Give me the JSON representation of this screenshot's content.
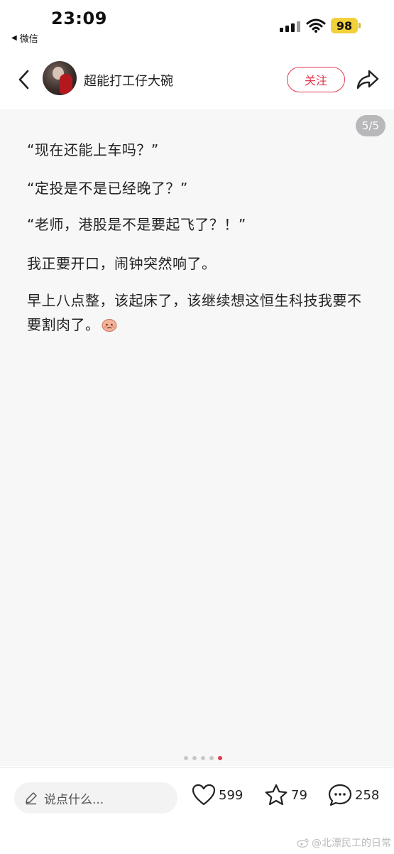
{
  "status_bar": {
    "time": "23:09",
    "back_app_label": "微信",
    "battery": "98",
    "colors": {
      "battery": "#f2d03a"
    }
  },
  "header": {
    "author_name": "超能打工仔大碗",
    "follow_label": "关注",
    "icons": [
      "chevron-left-icon",
      "share-arrow-icon"
    ]
  },
  "post": {
    "page_indicator": "5/5",
    "paragraphs": [
      "“现在还能上车吗？”",
      "“定投是不是已经晚了？”",
      "“老师，港股是不是要起飞了？！”",
      "我正要开口，闹钟突然响了。",
      "早上八点整，该起床了，该继续想这恒生科技我要不要割肉了。"
    ],
    "slides_total": 5,
    "slides_active": 5
  },
  "bottom_bar": {
    "comment_placeholder": "说点什么...",
    "likes": "599",
    "favorites": "79",
    "comments": "258"
  },
  "watermark": "@北漂民工的日常",
  "colors": {
    "accent": "#e5374d",
    "content_bg": "#f7f7f8"
  }
}
